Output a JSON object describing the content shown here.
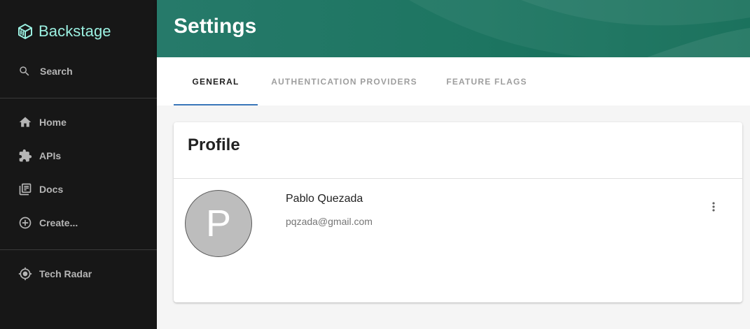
{
  "app": {
    "name": "Backstage"
  },
  "sidebar": {
    "search_label": "Search",
    "items": [
      {
        "label": "Home",
        "icon": "home-icon"
      },
      {
        "label": "APIs",
        "icon": "puzzle-icon"
      },
      {
        "label": "Docs",
        "icon": "library-books-icon"
      },
      {
        "label": "Create...",
        "icon": "add-circle-outline-icon"
      }
    ],
    "plugins": [
      {
        "label": "Tech Radar",
        "icon": "radar-icon"
      }
    ]
  },
  "header": {
    "title": "Settings"
  },
  "tabs": [
    {
      "label": "GENERAL",
      "active": true
    },
    {
      "label": "AUTHENTICATION PROVIDERS",
      "active": false
    },
    {
      "label": "FEATURE FLAGS",
      "active": false
    }
  ],
  "profile": {
    "title": "Profile",
    "avatar_letter": "P",
    "name": "Pablo Quezada",
    "email": "pqzada@gmail.com",
    "menu_icon": "more-vert-icon"
  },
  "colors": {
    "sidebar_bg": "#171717",
    "logo_accent": "#9bf0e1",
    "header_bg": "#1d7561",
    "tab_indicator": "#3a77b9",
    "avatar_bg": "#bdbdbd"
  }
}
